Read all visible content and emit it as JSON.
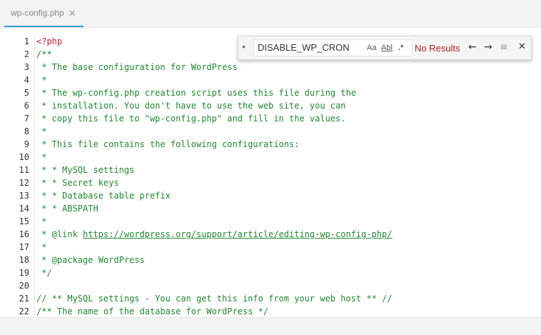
{
  "tab": {
    "label": "wp-config.php",
    "close": "✕"
  },
  "find": {
    "toggle": "▸",
    "query": "DISABLE_WP_CRON",
    "match_case": "Aa",
    "whole_word": "Abl",
    "regex": ".*",
    "status": "No Results",
    "prev": "←",
    "next": "→",
    "selection": "≡",
    "close": "✕"
  },
  "lines": [
    {
      "n": "1",
      "t": "<?php",
      "k": "tag"
    },
    {
      "n": "2",
      "t": "/**",
      "k": "comment"
    },
    {
      "n": "3",
      "t": " * The base configuration for WordPress",
      "k": "comment"
    },
    {
      "n": "4",
      "t": " *",
      "k": "comment"
    },
    {
      "n": "5",
      "t": " * The wp-config.php creation script uses this file during the",
      "k": "comment"
    },
    {
      "n": "6",
      "t": " * installation. You don't have to use the web site, you can",
      "k": "comment"
    },
    {
      "n": "7",
      "t": " * copy this file to \"wp-config.php\" and fill in the values.",
      "k": "comment"
    },
    {
      "n": "8",
      "t": " *",
      "k": "comment"
    },
    {
      "n": "9",
      "t": " * This file contains the following configurations:",
      "k": "comment"
    },
    {
      "n": "10",
      "t": " *",
      "k": "comment"
    },
    {
      "n": "11",
      "t": " * * MySQL settings",
      "k": "comment"
    },
    {
      "n": "12",
      "t": " * * Secret keys",
      "k": "comment"
    },
    {
      "n": "13",
      "t": " * * Database table prefix",
      "k": "comment"
    },
    {
      "n": "14",
      "t": " * * ABSPATH",
      "k": "comment"
    },
    {
      "n": "15",
      "t": " *",
      "k": "comment"
    },
    {
      "n": "16",
      "t": " * @link ",
      "k": "comment",
      "link": "https://wordpress.org/support/article/editing-wp-config-php/"
    },
    {
      "n": "17",
      "t": " *",
      "k": "comment"
    },
    {
      "n": "18",
      "t": " * @package WordPress",
      "k": "comment"
    },
    {
      "n": "19",
      "t": " */",
      "k": "comment"
    },
    {
      "n": "20",
      "t": "",
      "k": "comment"
    },
    {
      "n": "21",
      "t": "// ** MySQL settings - You can get this info from your web host ** //",
      "k": "comment"
    },
    {
      "n": "22",
      "t": "/** The name of the database for WordPress */",
      "k": "comment"
    }
  ]
}
